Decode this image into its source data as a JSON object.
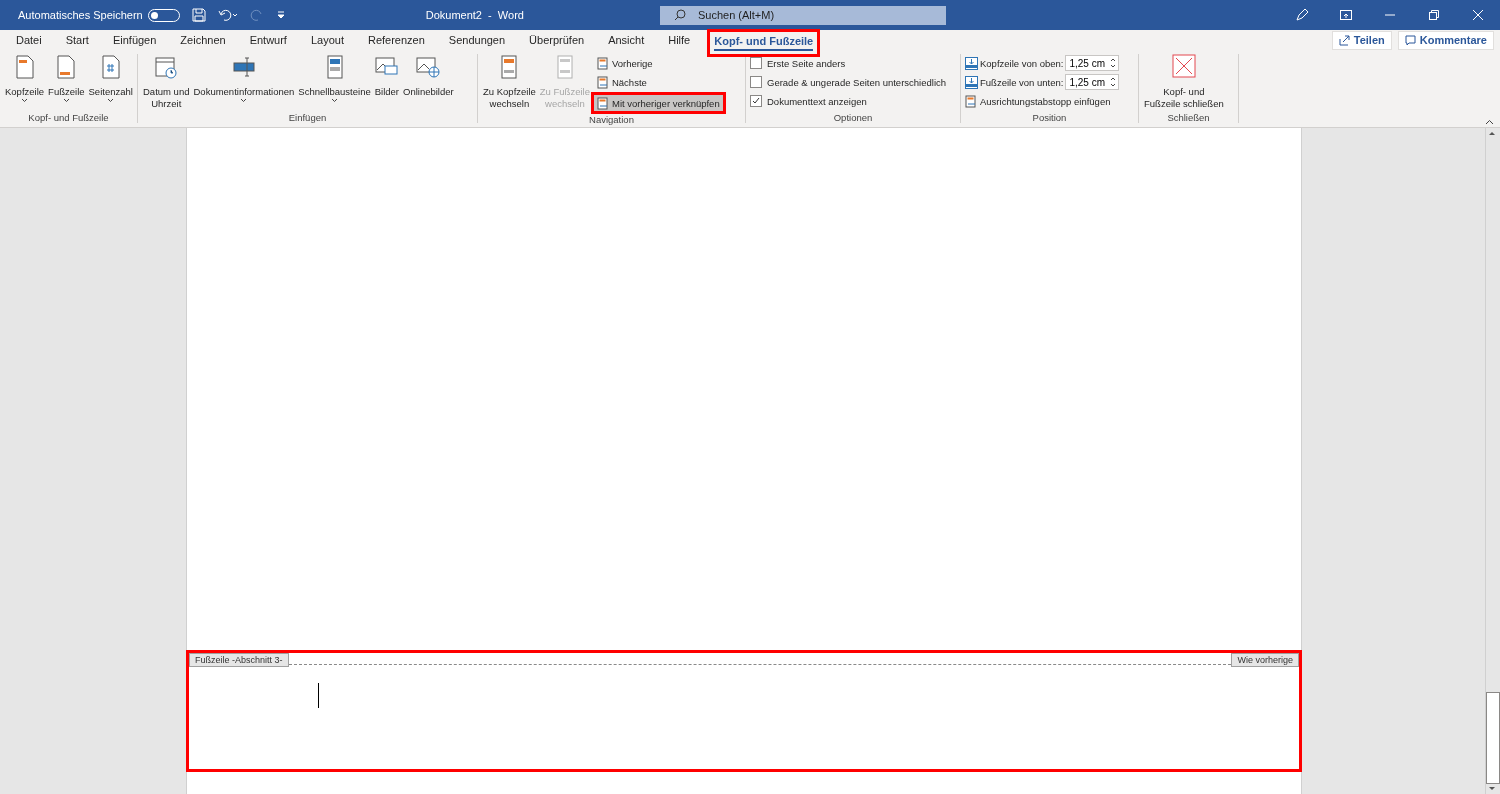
{
  "title_bar": {
    "autosave_label": "Automatisches Speichern",
    "autosave_on": false,
    "document_title": "Dokument2  -  Word",
    "search_placeholder": "Suchen (Alt+M)"
  },
  "tabs": [
    {
      "label": "Datei",
      "selected": false,
      "highlighted": false
    },
    {
      "label": "Start",
      "selected": false,
      "highlighted": false
    },
    {
      "label": "Einfügen",
      "selected": false,
      "highlighted": false
    },
    {
      "label": "Zeichnen",
      "selected": false,
      "highlighted": false
    },
    {
      "label": "Entwurf",
      "selected": false,
      "highlighted": false
    },
    {
      "label": "Layout",
      "selected": false,
      "highlighted": false
    },
    {
      "label": "Referenzen",
      "selected": false,
      "highlighted": false
    },
    {
      "label": "Sendungen",
      "selected": false,
      "highlighted": false
    },
    {
      "label": "Überprüfen",
      "selected": false,
      "highlighted": false
    },
    {
      "label": "Ansicht",
      "selected": false,
      "highlighted": false
    },
    {
      "label": "Hilfe",
      "selected": false,
      "highlighted": false
    },
    {
      "label": "Kopf- und Fußzeile",
      "selected": true,
      "highlighted": true
    }
  ],
  "share_buttons": [
    {
      "label": "Teilen",
      "kind": "share"
    },
    {
      "label": "Kommentare",
      "kind": "comment"
    }
  ],
  "ribbon_groups": [
    {
      "label": "Kopf- und Fußzeile",
      "items": [
        {
          "kind": "large",
          "label": "Kopfzeile",
          "dropdown": true,
          "disabled": false
        },
        {
          "kind": "large",
          "label": "Fußzeile",
          "dropdown": true,
          "disabled": false
        },
        {
          "kind": "large",
          "label": "Seitenzahl",
          "dropdown": true,
          "disabled": false
        }
      ]
    },
    {
      "label": "Einfügen",
      "items": [
        {
          "kind": "large",
          "label": "Datum und\nUhrzeit",
          "dropdown": false,
          "disabled": false
        },
        {
          "kind": "large",
          "label": "Dokumentinformationen",
          "dropdown": true,
          "disabled": false
        },
        {
          "kind": "large",
          "label": "Schnellbausteine",
          "dropdown": true,
          "disabled": false
        },
        {
          "kind": "large",
          "label": "Bilder",
          "dropdown": false,
          "disabled": false
        },
        {
          "kind": "large",
          "label": "Onlinebilder",
          "dropdown": false,
          "disabled": false
        }
      ]
    },
    {
      "label": "Navigation",
      "items": [
        {
          "kind": "large",
          "label": "Zu Kopfzeile\nwechseln",
          "dropdown": false,
          "disabled": false
        },
        {
          "kind": "large",
          "label": "Zu Fußzeile\nwechseln",
          "dropdown": false,
          "disabled": true
        },
        {
          "kind": "small",
          "label": "Vorherige",
          "selected": false,
          "highlighted": false
        },
        {
          "kind": "small",
          "label": "Nächste",
          "selected": false,
          "highlighted": false
        },
        {
          "kind": "small",
          "label": "Mit vorheriger verknüpfen",
          "selected": true,
          "highlighted": true
        }
      ]
    },
    {
      "label": "Optionen",
      "items": [
        {
          "kind": "checkbox",
          "label": "Erste Seite anders",
          "checked": false
        },
        {
          "kind": "checkbox",
          "label": "Gerade & ungerade Seiten unterschiedlich",
          "checked": false
        },
        {
          "kind": "checkbox",
          "label": "Dokumenttext anzeigen",
          "checked": true
        }
      ]
    },
    {
      "label": "Position",
      "items": [
        {
          "kind": "spin",
          "label": "Kopfzeile von oben:",
          "value": "1,25 cm"
        },
        {
          "kind": "spin",
          "label": "Fußzeile von unten:",
          "value": "1,25 cm"
        },
        {
          "kind": "small",
          "label": "Ausrichtungstabstopp einfügen",
          "selected": false,
          "highlighted": false
        }
      ]
    },
    {
      "label": "Schließen",
      "items": [
        {
          "kind": "large",
          "label": "Kopf- und\nFußzeile schließen",
          "dropdown": false,
          "disabled": false
        }
      ]
    }
  ],
  "footer_area": {
    "label": "Fußzeile -Abschnitt 3-",
    "link_label": "Wie vorherige",
    "highlighted": true
  }
}
